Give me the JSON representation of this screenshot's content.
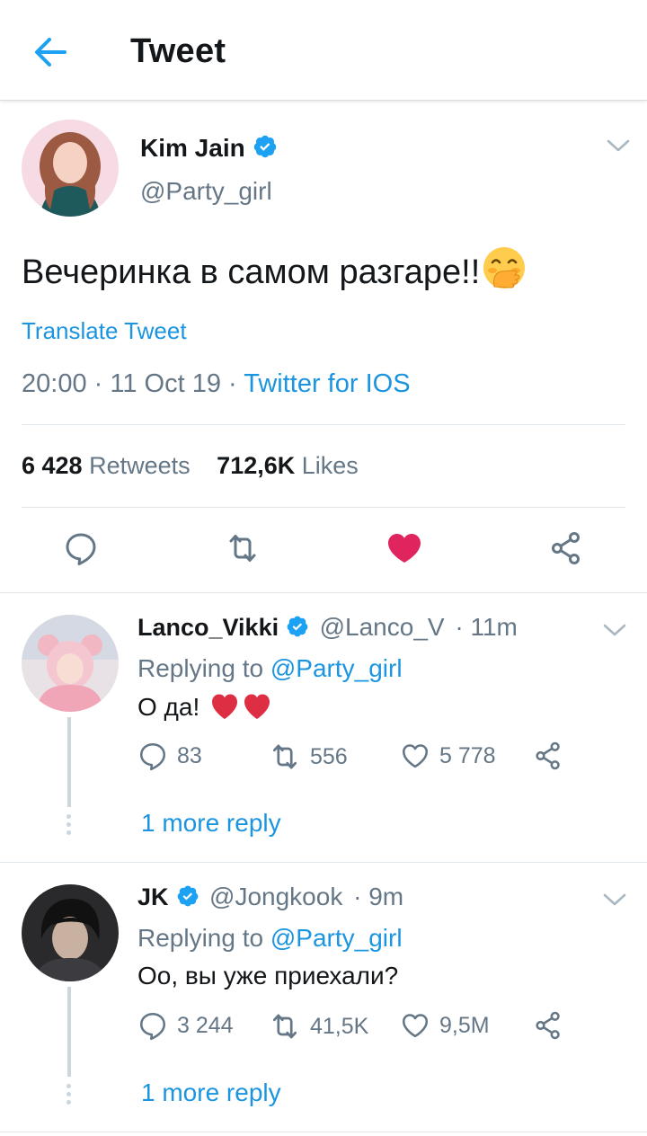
{
  "header": {
    "title": "Tweet",
    "back_icon": "arrow-left-icon"
  },
  "colors": {
    "accent": "#1b95e0",
    "like": "#e0245e",
    "secondary_text": "#657786",
    "primary_text": "#14171a"
  },
  "main_tweet": {
    "name": "Kim Jain",
    "handle": "@Party_girl",
    "text": "Вечеринка в самом разгаре!!",
    "emoji": "hand-over-mouth-emoji",
    "translate": "Translate Tweet",
    "time": "20:00",
    "date": "11 Oct 19",
    "source": "Twitter for IOS",
    "retweets_count": "6 428",
    "retweets_label": "Retweets",
    "likes_count": "712,6K",
    "likes_label": "Likes",
    "liked": true
  },
  "replies": [
    {
      "name": "Lanco_Vikki",
      "handle": "@Lanco_V",
      "time": "11m",
      "replying_label": "Replying to",
      "replying_to": "@Party_girl",
      "text": "О да!",
      "text_emoji": "red-heart-emoji x2",
      "comments": "83",
      "retweets": "556",
      "likes": "5 778",
      "more_replies": "1 more reply"
    },
    {
      "name": "JK",
      "handle": "@Jongkook",
      "time": "9m",
      "replying_label": "Replying to",
      "replying_to": "@Party_girl",
      "text": "Оо, вы уже приехали?",
      "comments": "3 244",
      "retweets": "41,5K",
      "likes": "9,5M",
      "more_replies": "1 more reply"
    }
  ]
}
